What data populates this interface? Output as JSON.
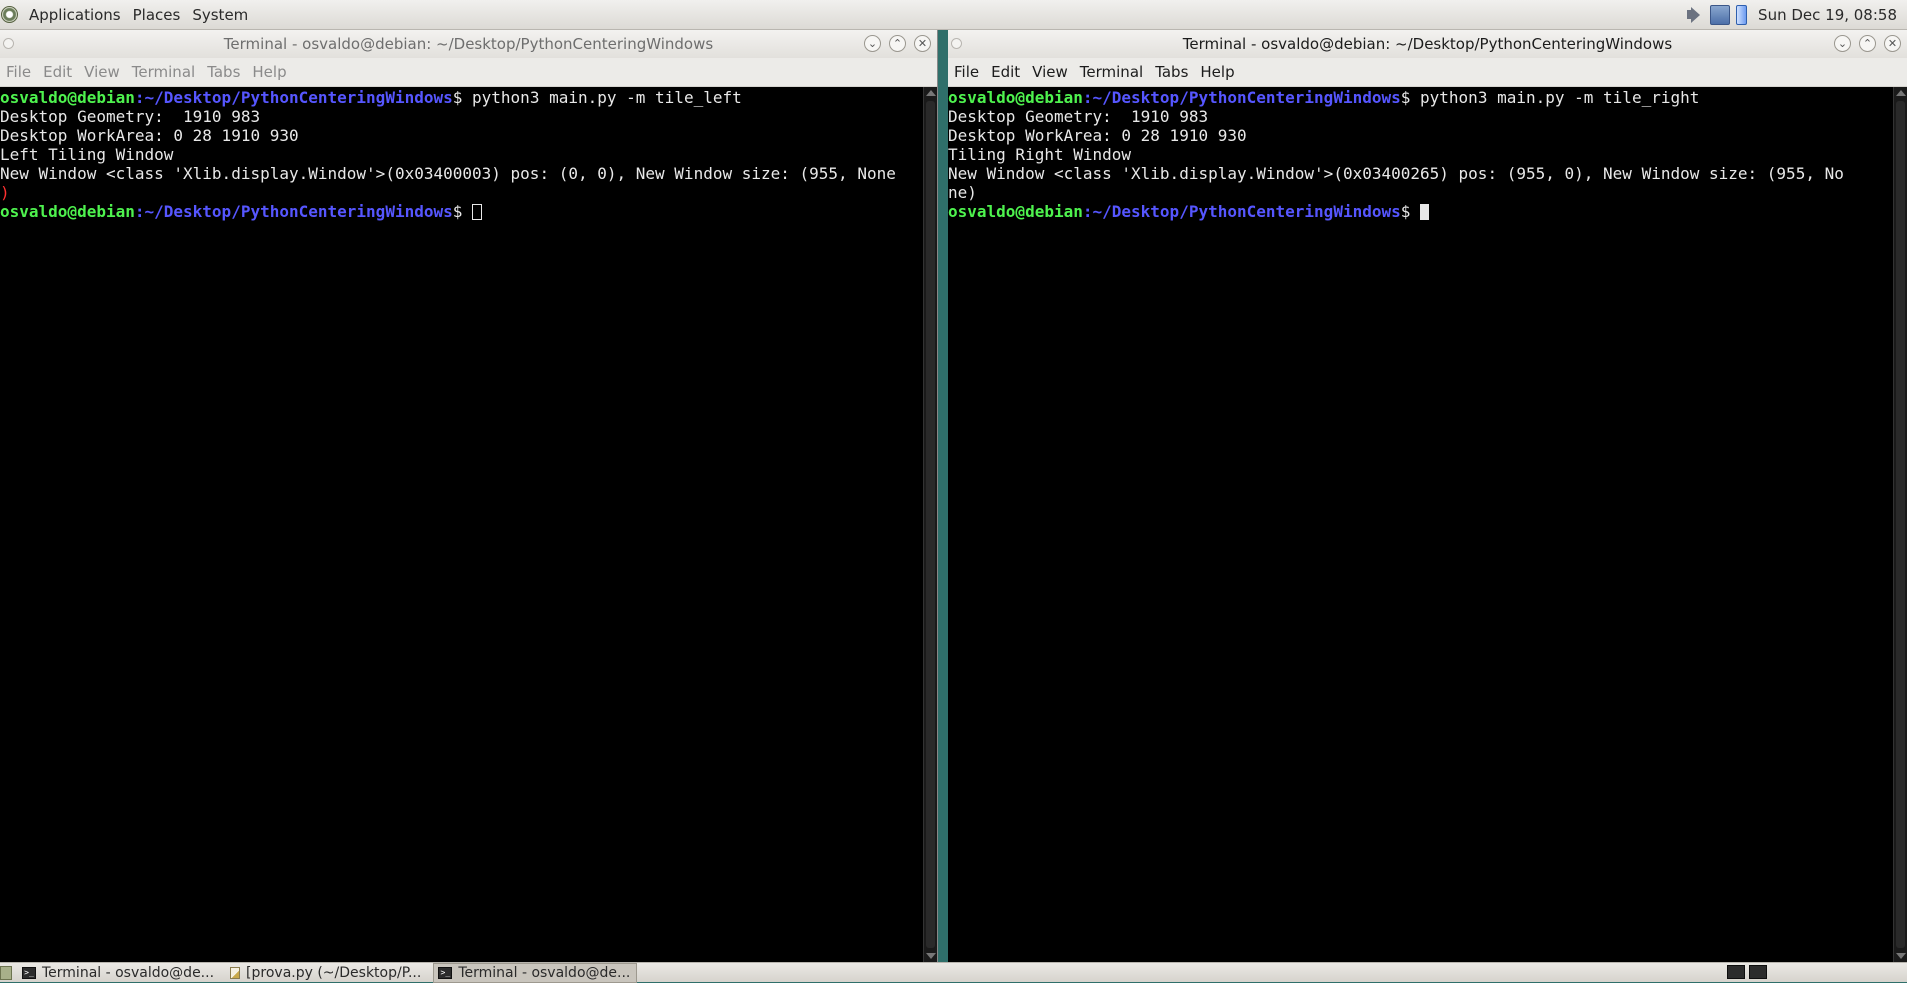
{
  "top_panel": {
    "menus": [
      "Applications",
      "Places",
      "System"
    ],
    "clock": "Sun Dec 19, 08:58"
  },
  "left_window": {
    "title": "Terminal - osvaldo@debian: ~/Desktop/PythonCenteringWindows",
    "menu": [
      "File",
      "Edit",
      "View",
      "Terminal",
      "Tabs",
      "Help"
    ],
    "prompt_user": "osvaldo@debian",
    "prompt_path": ":~/Desktop/PythonCenteringWindows",
    "prompt_symbol": "$ ",
    "command": "python3 main.py -m tile_left",
    "output": [
      "Desktop Geometry:  1910 983",
      "Desktop WorkArea: 0 28 1910 930",
      "Left Tiling Window",
      "New Window <class 'Xlib.display.Window'>(0x03400003) pos: (0, 0), New Window size: (955, None"
    ],
    "wrap_char": ")"
  },
  "right_window": {
    "title": "Terminal - osvaldo@debian: ~/Desktop/PythonCenteringWindows",
    "menu": [
      "File",
      "Edit",
      "View",
      "Terminal",
      "Tabs",
      "Help"
    ],
    "prompt_user": "osvaldo@debian",
    "prompt_path": ":~/Desktop/PythonCenteringWindows",
    "prompt_symbol": "$ ",
    "command": "python3 main.py -m tile_right",
    "output": [
      "Desktop Geometry:  1910 983",
      "Desktop WorkArea: 0 28 1910 930",
      "Tiling Right Window",
      "New Window <class 'Xlib.display.Window'>(0x03400265) pos: (955, 0), New Window size: (955, No",
      "ne)"
    ]
  },
  "taskbar": {
    "tasks": [
      "Terminal - osvaldo@de...",
      "[prova.py (~/Desktop/P...",
      "Terminal - osvaldo@de..."
    ]
  }
}
